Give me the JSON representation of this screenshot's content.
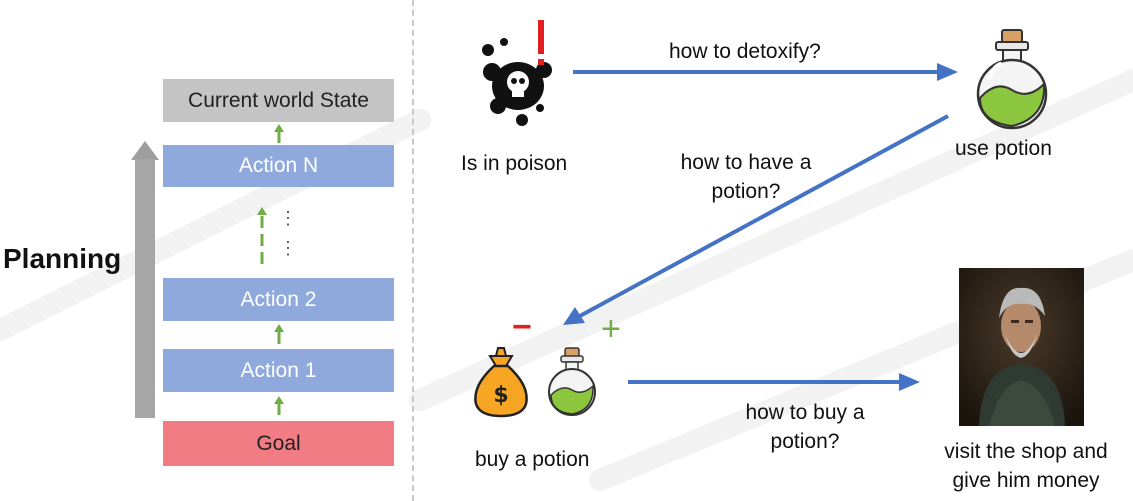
{
  "planning": {
    "title": "Planning",
    "boxes": {
      "current_state": "Current world State",
      "action_n": "Action N",
      "action_2": "Action 2",
      "action_1": "Action 1",
      "goal": "Goal"
    },
    "ellipsis": "⋮"
  },
  "nodes": {
    "poison": "Is in poison",
    "use_potion": "use potion",
    "buy_potion": "buy a potion",
    "shop": "visit the shop and give him money"
  },
  "edges": {
    "detoxify": "how to detoxify?",
    "have_potion": "how to have a potion?",
    "buy": "how to buy a potion?"
  },
  "signs": {
    "minus": "−",
    "plus": "+"
  },
  "colors": {
    "arrow_blue": "#4472c4",
    "green_arrow": "#70ad47",
    "box_blue": "#8fa9dc",
    "goal_red": "#f27c84",
    "state_grey": "#c4c4c4",
    "potion_green": "#8cc63f",
    "bag_orange": "#f6a623"
  }
}
